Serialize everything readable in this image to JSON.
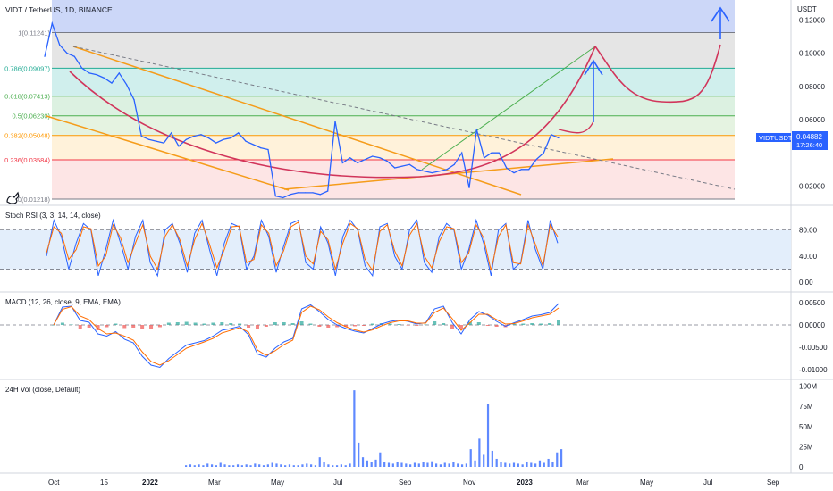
{
  "header": {
    "title": "VIDT / TetherUS, 1D, BINANCE",
    "currency": "USDT"
  },
  "price_tag": {
    "symbol": "VIDTUSDT",
    "value": "0.04882",
    "countdown": "17:26:40",
    "color": "#2962ff"
  },
  "fib_levels": [
    {
      "ratio": "1",
      "price": "0.11241",
      "value": 0.11241,
      "color": "#787b86"
    },
    {
      "ratio": "0.786",
      "price": "0.09097",
      "value": 0.09097,
      "color": "#22ab94"
    },
    {
      "ratio": "0.618",
      "price": "0.07413",
      "value": 0.07413,
      "color": "#4caf50"
    },
    {
      "ratio": "0.5",
      "price": "0.06230",
      "value": 0.0623,
      "color": "#4caf50"
    },
    {
      "ratio": "0.382",
      "price": "0.05048",
      "value": 0.05048,
      "color": "#ff9800"
    },
    {
      "ratio": "0.236",
      "price": "0.03584",
      "value": 0.03584,
      "color": "#f23645"
    },
    {
      "ratio": "0",
      "price": "0.01218",
      "value": 0.01218,
      "color": "#787b86"
    }
  ],
  "price_axis": {
    "ticks": [
      "0.12000",
      "0.10000",
      "0.08000",
      "0.06000",
      "0.02000"
    ],
    "tick_values": [
      0.12,
      0.1,
      0.08,
      0.06,
      0.02
    ]
  },
  "time_axis": {
    "labels": [
      "Oct",
      "15",
      "2022",
      "Mar",
      "May",
      "Jul",
      "Sep",
      "Nov",
      "2023",
      "Mar",
      "May",
      "Jul",
      "Sep"
    ]
  },
  "panes": {
    "stoch": {
      "title": "Stoch RSI (3, 3, 14, 14, close)",
      "ticks": [
        "80.00",
        "40.00",
        "0.00"
      ],
      "tick_values": [
        80,
        40,
        0
      ],
      "band": [
        20,
        80
      ]
    },
    "macd": {
      "title": "MACD (12, 26, close, 9, EMA, EMA)",
      "ticks": [
        "0.00500",
        "0.00000",
        "-0.00500",
        "-0.01000"
      ],
      "tick_values": [
        0.005,
        0,
        -0.005,
        -0.01
      ]
    },
    "volume": {
      "title": "24H Vol (close, Default)",
      "ticks": [
        "100M",
        "75M",
        "50M",
        "25M",
        "0"
      ],
      "tick_values": [
        100,
        75,
        50,
        25,
        0
      ]
    }
  },
  "chart_data": [
    {
      "type": "line",
      "pane": "price",
      "x": [
        "2021-10-01",
        "2021-10-08",
        "2021-10-15",
        "2021-10-22",
        "2021-10-29",
        "2021-11-05",
        "2021-11-12",
        "2021-11-19",
        "2021-11-26",
        "2021-12-03",
        "2021-12-10",
        "2021-12-17",
        "2021-12-24",
        "2022-01-01",
        "2022-01-08",
        "2022-01-15",
        "2022-01-22",
        "2022-01-29",
        "2022-02-05",
        "2022-02-12",
        "2022-02-19",
        "2022-02-26",
        "2022-03-05",
        "2022-03-12",
        "2022-03-19",
        "2022-03-26",
        "2022-04-02",
        "2022-04-09",
        "2022-04-16",
        "2022-04-23",
        "2022-04-30",
        "2022-05-07",
        "2022-05-14",
        "2022-05-21",
        "2022-05-28",
        "2022-06-04",
        "2022-06-11",
        "2022-06-18",
        "2022-06-25",
        "2022-07-02",
        "2022-07-09",
        "2022-07-16",
        "2022-07-23",
        "2022-07-30",
        "2022-08-06",
        "2022-08-13",
        "2022-08-20",
        "2022-08-27",
        "2022-09-03",
        "2022-09-10",
        "2022-09-17",
        "2022-09-24",
        "2022-10-01",
        "2022-10-08",
        "2022-10-15",
        "2022-10-22",
        "2022-10-29",
        "2022-11-05",
        "2022-11-12",
        "2022-11-19",
        "2022-11-26",
        "2022-12-03",
        "2022-12-10",
        "2022-12-17",
        "2022-12-24",
        "2022-12-31",
        "2023-01-07",
        "2023-01-14",
        "2023-01-21",
        "2023-01-28"
      ],
      "values": [
        0.098,
        0.118,
        0.105,
        0.1,
        0.098,
        0.091,
        0.088,
        0.087,
        0.085,
        0.082,
        0.088,
        0.081,
        0.072,
        0.05,
        0.048,
        0.047,
        0.046,
        0.052,
        0.044,
        0.048,
        0.05,
        0.051,
        0.049,
        0.046,
        0.048,
        0.049,
        0.052,
        0.047,
        0.045,
        0.043,
        0.042,
        0.014,
        0.013,
        0.015,
        0.016,
        0.016,
        0.016,
        0.015,
        0.017,
        0.059,
        0.034,
        0.037,
        0.034,
        0.036,
        0.038,
        0.037,
        0.035,
        0.031,
        0.032,
        0.033,
        0.03,
        0.029,
        0.028,
        0.029,
        0.03,
        0.033,
        0.04,
        0.019,
        0.054,
        0.037,
        0.04,
        0.04,
        0.031,
        0.028,
        0.03,
        0.03,
        0.036,
        0.04,
        0.051,
        0.049
      ],
      "ylim": [
        0.0095,
        0.132
      ],
      "series": [
        {
          "name": "VIDTUSDT",
          "color": "#2962ff"
        }
      ]
    },
    {
      "type": "line",
      "pane": "stoch",
      "ylim": [
        -12,
        115
      ],
      "series": [
        {
          "name": "K",
          "color": "#2962ff",
          "values": [
            40,
            95,
            70,
            20,
            60,
            90,
            80,
            10,
            50,
            95,
            60,
            20,
            70,
            95,
            30,
            10,
            80,
            90,
            60,
            15,
            75,
            95,
            50,
            10,
            60,
            90,
            85,
            20,
            40,
            95,
            70,
            15,
            55,
            90,
            95,
            30,
            20,
            85,
            60,
            10,
            70,
            95,
            80,
            25,
            10,
            85,
            90,
            40,
            20,
            80,
            95,
            30,
            15,
            70,
            90,
            80,
            20,
            50,
            95,
            60,
            10,
            80,
            90,
            20,
            30,
            95,
            50,
            20,
            95,
            60
          ]
        },
        {
          "name": "D",
          "color": "#ff6d00",
          "values": [
            45,
            85,
            75,
            35,
            50,
            85,
            82,
            25,
            40,
            88,
            68,
            30,
            60,
            88,
            40,
            20,
            70,
            88,
            65,
            25,
            65,
            90,
            58,
            22,
            50,
            85,
            86,
            30,
            35,
            88,
            75,
            25,
            48,
            85,
            92,
            40,
            28,
            78,
            65,
            20,
            60,
            90,
            82,
            35,
            18,
            78,
            88,
            48,
            25,
            72,
            90,
            40,
            22,
            62,
            85,
            82,
            30,
            45,
            88,
            68,
            18,
            70,
            88,
            30,
            28,
            88,
            58,
            25,
            88,
            70
          ]
        }
      ]
    },
    {
      "type": "line",
      "pane": "macd",
      "ylim": [
        -0.0118,
        0.0066
      ],
      "series": [
        {
          "name": "MACD",
          "color": "#2962ff",
          "values": [
            0,
            0.004,
            0.0042,
            0.001,
            0.0006,
            -0.002,
            -0.0025,
            -0.0015,
            -0.0032,
            -0.004,
            -0.007,
            -0.009,
            -0.0095,
            -0.0075,
            -0.006,
            -0.0045,
            -0.004,
            -0.0035,
            -0.0025,
            -0.0012,
            -0.0008,
            -0.0003,
            -0.0022,
            -0.0065,
            -0.0072,
            -0.0052,
            -0.0038,
            -0.003,
            0.0036,
            0.0045,
            0.003,
            0.0012,
            0,
            -0.0008,
            -0.0014,
            -0.0018,
            -0.0008,
            0.0002,
            0.0008,
            0.0011,
            0.0008,
            0.0002,
            0.0005,
            0.0036,
            0.0042,
            0.0005,
            -0.002,
            0.0012,
            0.003,
            0.0022,
            0.0008,
            -0.0003,
            0.0005,
            0.0012,
            0.002,
            0.0023,
            0.0028,
            0.0048
          ]
        },
        {
          "name": "Signal",
          "color": "#ff6d00",
          "values": [
            0,
            0.0035,
            0.0041,
            0.002,
            0.0012,
            -0.0008,
            -0.002,
            -0.0018,
            -0.0025,
            -0.0034,
            -0.006,
            -0.0082,
            -0.009,
            -0.008,
            -0.0066,
            -0.0052,
            -0.0045,
            -0.0038,
            -0.003,
            -0.0018,
            -0.0012,
            -0.0006,
            -0.0016,
            -0.0056,
            -0.0068,
            -0.0058,
            -0.0044,
            -0.0034,
            0.0028,
            0.0042,
            0.0034,
            0.0018,
            0.0005,
            -0.0004,
            -0.0011,
            -0.0016,
            -0.0011,
            -0.0002,
            0.0005,
            0.0009,
            0.0009,
            0.0004,
            0.0004,
            0.0028,
            0.0038,
            0.0014,
            -0.0012,
            0.0005,
            0.0024,
            0.0024,
            0.0012,
            0.0002,
            0.0003,
            0.0009,
            0.0016,
            0.002,
            0.0024,
            0.0038
          ]
        }
      ]
    },
    {
      "type": "bar",
      "pane": "volume",
      "name": "24H Vol",
      "ylim": [
        0,
        104
      ],
      "values": [
        2,
        3,
        2,
        3,
        2,
        4,
        3,
        2,
        5,
        3,
        2,
        2,
        3,
        2,
        3,
        2,
        4,
        3,
        2,
        3,
        5,
        4,
        3,
        2,
        3,
        2,
        2,
        3,
        4,
        3,
        2,
        12,
        6,
        3,
        2,
        2,
        3,
        2,
        4,
        95,
        30,
        12,
        8,
        6,
        9,
        18,
        6,
        5,
        4,
        6,
        5,
        4,
        3,
        5,
        4,
        6,
        5,
        7,
        4,
        3,
        5,
        4,
        6,
        4,
        3,
        4,
        22,
        8,
        35,
        15,
        78,
        20,
        10,
        6,
        5,
        4,
        5,
        4,
        3,
        6,
        5,
        4,
        8,
        5,
        10,
        6,
        18,
        22
      ]
    }
  ]
}
